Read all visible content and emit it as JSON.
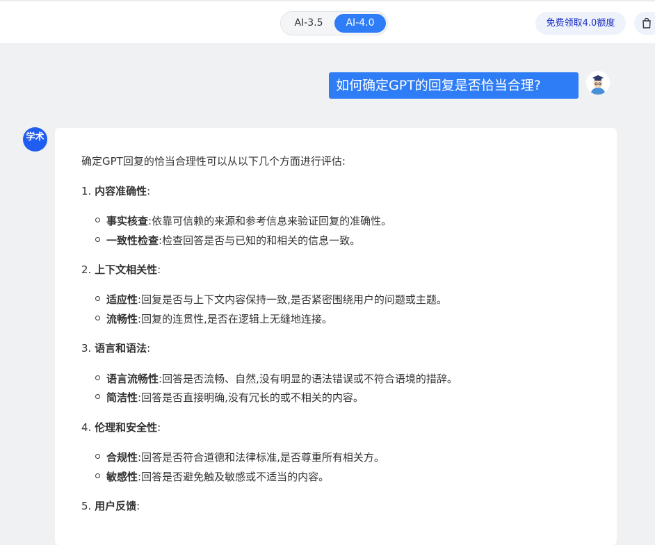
{
  "header": {
    "model_options": [
      "AI-3.5",
      "AI-4.0"
    ],
    "selected_model": "AI-4.0",
    "quota_button": "免费领取4.0额度"
  },
  "chat": {
    "user_message": "如何确定GPT的回复是否恰当合理?",
    "bot_avatar_text": "学术",
    "answer": {
      "intro": "确定GPT回复的恰当合理性可以从以下几个方面进行评估:",
      "sections": [
        {
          "num": "1.",
          "title": "内容准确性",
          "items": [
            {
              "term": "事实核查",
              "desc": "依靠可信赖的来源和参考信息来验证回复的准确性。"
            },
            {
              "term": "一致性检查",
              "desc": "检查回答是否与已知的和相关的信息一致。"
            }
          ]
        },
        {
          "num": "2.",
          "title": "上下文相关性",
          "items": [
            {
              "term": "适应性",
              "desc": "回复是否与上下文内容保持一致,是否紧密围绕用户的问题或主题。"
            },
            {
              "term": "流畅性",
              "desc": "回复的连贯性,是否在逻辑上无缝地连接。"
            }
          ]
        },
        {
          "num": "3.",
          "title": "语言和语法",
          "items": [
            {
              "term": "语言流畅性",
              "desc": "回答是否流畅、自然,没有明显的语法错误或不符合语境的措辞。"
            },
            {
              "term": "简洁性",
              "desc": "回答是否直接明确,没有冗长的或不相关的内容。"
            }
          ]
        },
        {
          "num": "4.",
          "title": "伦理和安全性",
          "items": [
            {
              "term": "合规性",
              "desc": "回答是否符合道德和法律标准,是否尊重所有相关方。"
            },
            {
              "term": "敏感性",
              "desc": "回答是否避免触及敏感或不适当的内容。"
            }
          ]
        },
        {
          "num": "5.",
          "title": "用户反馈",
          "items": []
        }
      ]
    }
  },
  "colors": {
    "accent": "#2e7cf6",
    "quota_text": "#1a2ec0",
    "background": "#f0f1f2"
  },
  "icons": [
    "shopping-bag-icon",
    "user-avatar-icon",
    "bot-avatar-icon"
  ]
}
